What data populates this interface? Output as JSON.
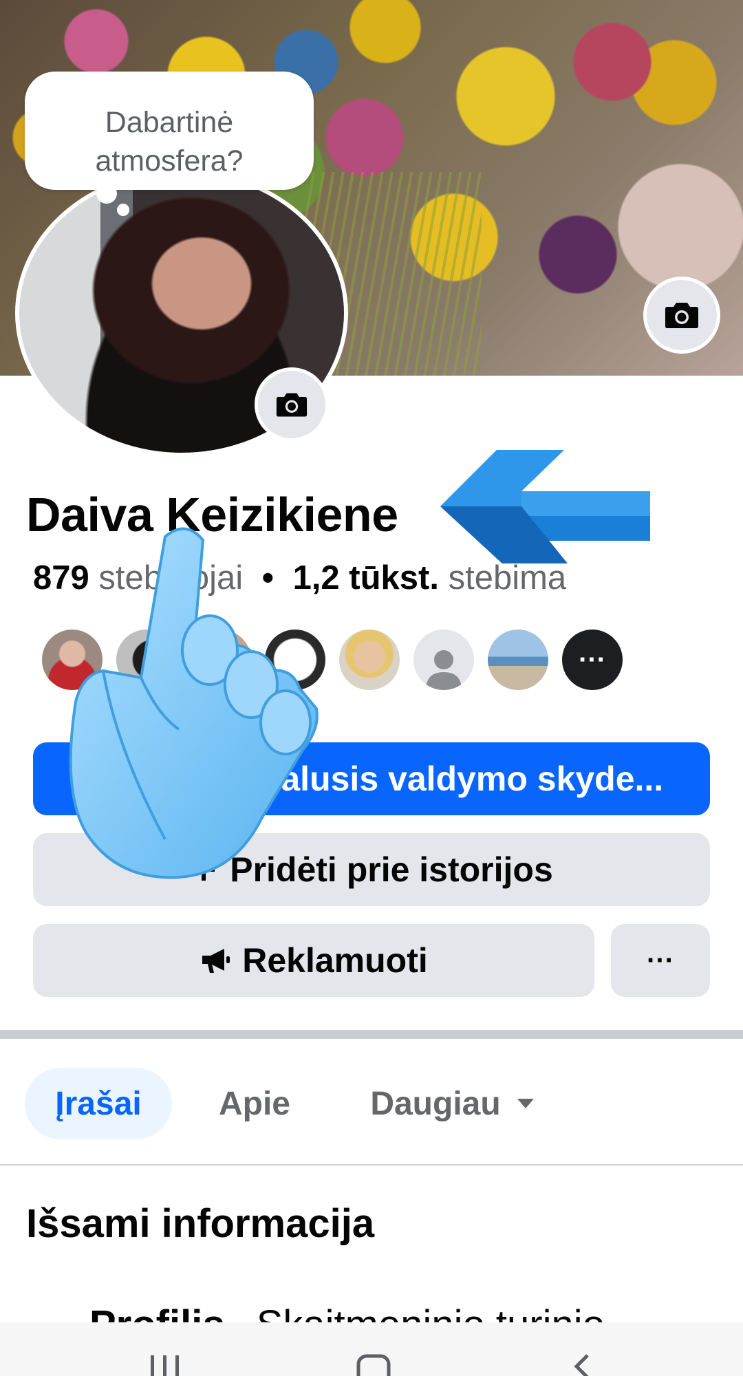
{
  "cover": {
    "camera_icon": "camera-icon"
  },
  "status_bubble": {
    "text_line1": "Dabartinė",
    "text_line2": "atmosfera?"
  },
  "profile": {
    "name": "Daiva Keizikiene",
    "followers_count": "879",
    "followers_label": "stebėtojai",
    "following_count": "1,2 tūkst.",
    "following_label": "stebima",
    "separator": "•"
  },
  "follower_avatars": {
    "more_label": "···"
  },
  "buttons": {
    "dashboard": "Profesionalusis valdymo skyde...",
    "add_story": "Pridėti prie istorijos",
    "promote": "Reklamuoti",
    "more": "···"
  },
  "tabs": [
    {
      "label": "Įrašai",
      "active": true
    },
    {
      "label": "Apie",
      "active": false
    },
    {
      "label": "Daugiau",
      "active": false
    }
  ],
  "details": {
    "title": "Išsami informacija",
    "partial_row_label": "Profilis",
    "partial_row_value": "Skaitmeninio turinio"
  },
  "colors": {
    "accent": "#0866ff",
    "button_grey": "#e4e6eb",
    "text_muted": "#65676b"
  }
}
